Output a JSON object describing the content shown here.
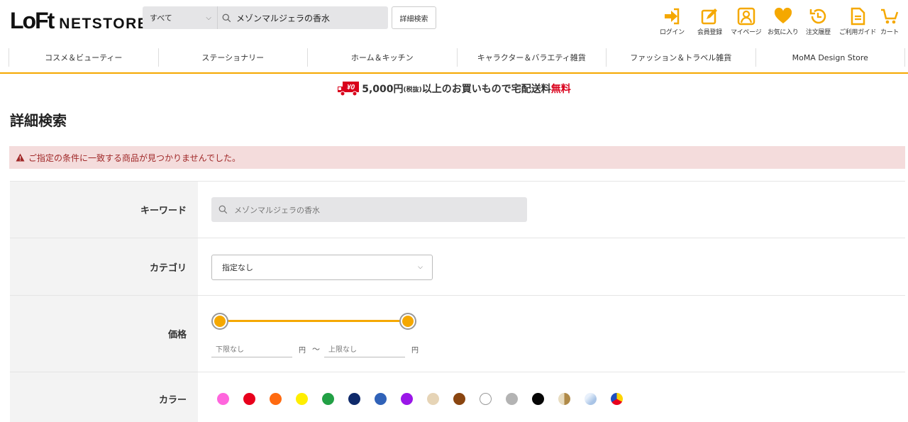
{
  "header": {
    "logo_main": "LoFt",
    "logo_sub": "NETSTORE",
    "search_scope": "すべて",
    "search_value": "メゾンマルジェラの香水",
    "advanced_search_label": "詳細検索",
    "utility": [
      {
        "label": "ログイン",
        "icon": "login-icon"
      },
      {
        "label": "会員登録",
        "icon": "register-icon"
      },
      {
        "label": "マイページ",
        "icon": "mypage-icon"
      },
      {
        "label": "お気に入り",
        "icon": "heart-icon"
      },
      {
        "label": "注文履歴",
        "icon": "history-icon"
      },
      {
        "label": "ご利用ガイド",
        "icon": "guide-icon"
      },
      {
        "label": "カート",
        "icon": "cart-icon"
      }
    ],
    "accent_color": "#f5a800"
  },
  "nav": {
    "items": [
      "コスメ＆ビューティー",
      "ステーショナリー",
      "ホーム＆キッチン",
      "キャラクター＆バラエティ雑貨",
      "ファッション＆トラベル雑貨",
      "MoMA Design Store"
    ]
  },
  "banner": {
    "badge": "¥0",
    "amount": "5,000円",
    "tax": "(税抜)",
    "middle": "以上のお買いもので宅配送料",
    "free": "無料"
  },
  "page_title": "詳細検索",
  "alert": {
    "message": "ご指定の条件に一致する商品が見つかりませんでした。",
    "color": "#f4dcdc"
  },
  "form": {
    "keyword_label": "キーワード",
    "keyword_value": "メゾンマルジェラの香水",
    "category_label": "カテゴリ",
    "category_value": "指定なし",
    "price_label": "価格",
    "price_min_placeholder": "下限なし",
    "price_max_placeholder": "上限なし",
    "price_unit": "円",
    "price_sep": "〜",
    "color_label": "カラー",
    "colors": [
      {
        "name": "pink",
        "hex": "#ff66dd"
      },
      {
        "name": "red",
        "hex": "#e8001c"
      },
      {
        "name": "orange",
        "hex": "#ff6a10"
      },
      {
        "name": "yellow",
        "hex": "#ffee00"
      },
      {
        "name": "green",
        "hex": "#22a045"
      },
      {
        "name": "navy",
        "hex": "#0f2a6b"
      },
      {
        "name": "blue",
        "hex": "#3062b8"
      },
      {
        "name": "purple",
        "hex": "#9a16e8"
      },
      {
        "name": "beige",
        "hex": "#e6d4b6"
      },
      {
        "name": "brown",
        "hex": "#8a4510"
      },
      {
        "name": "white",
        "hex": "#ffffff"
      },
      {
        "name": "gray",
        "hex": "#b3b3b3"
      },
      {
        "name": "black",
        "hex": "#050505"
      },
      {
        "name": "gold",
        "hex": "#c8a66a"
      },
      {
        "name": "silver",
        "hex": "#c8dcf0"
      },
      {
        "name": "multi",
        "hex": "#multi"
      }
    ]
  }
}
